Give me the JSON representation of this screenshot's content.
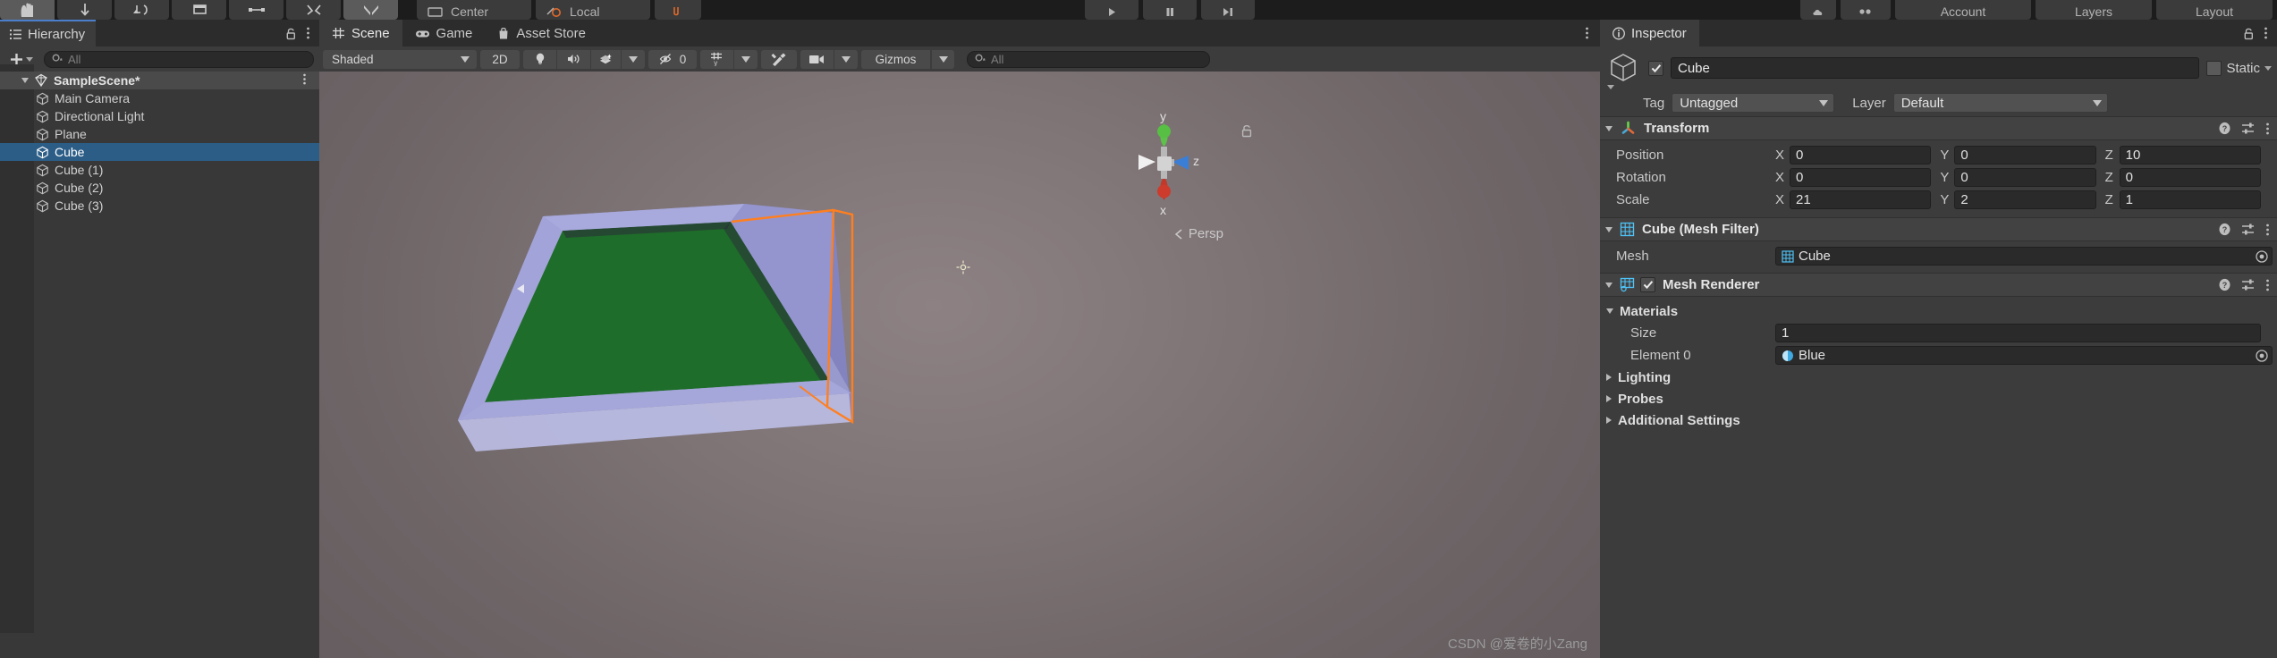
{
  "top_toolbar": {
    "tools": [
      {
        "name": "hand-tool",
        "icon": "hand",
        "active": true
      },
      {
        "name": "move-tool",
        "icon": "move"
      },
      {
        "name": "rotate-tool",
        "icon": "rotate"
      },
      {
        "name": "scale-tool",
        "icon": "scale"
      },
      {
        "name": "rect-tool",
        "icon": "rect"
      },
      {
        "name": "transform-tool",
        "icon": "transform"
      },
      {
        "name": "custom-tool",
        "icon": "custom"
      }
    ],
    "pivot_label": "Center",
    "handle_label": "Local",
    "play_label": "",
    "account_label": "Account",
    "layers_label": "Layers",
    "layout_label": "Layout"
  },
  "hierarchy": {
    "tab_label": "Hierarchy",
    "add_label": "+",
    "search_placeholder": "All",
    "items": [
      {
        "label": "SampleScene*",
        "depth": 0,
        "type": "scene",
        "expanded": true,
        "selected": false
      },
      {
        "label": "Main Camera",
        "depth": 1,
        "type": "gameobject",
        "selected": false
      },
      {
        "label": "Directional Light",
        "depth": 1,
        "type": "gameobject",
        "selected": false
      },
      {
        "label": "Plane",
        "depth": 1,
        "type": "gameobject",
        "selected": false
      },
      {
        "label": "Cube",
        "depth": 1,
        "type": "gameobject",
        "selected": true
      },
      {
        "label": "Cube (1)",
        "depth": 1,
        "type": "gameobject",
        "selected": false
      },
      {
        "label": "Cube (2)",
        "depth": 1,
        "type": "gameobject",
        "selected": false
      },
      {
        "label": "Cube (3)",
        "depth": 1,
        "type": "gameobject",
        "selected": false
      }
    ]
  },
  "scene_panel": {
    "tabs": [
      {
        "label": "Scene",
        "icon": "grid-icon",
        "active": true
      },
      {
        "label": "Game",
        "icon": "gamepad-icon",
        "active": false
      },
      {
        "label": "Asset Store",
        "icon": "store-icon",
        "active": false
      }
    ],
    "toolbar": {
      "draw_mode": "Shaded",
      "mode_2d": "2D",
      "lighting_icon": "lightbulb-icon",
      "audio_icon": "speaker-icon",
      "fx_icon": "effects-icon",
      "hidden_count": "0",
      "grid_icon": "grid-visibility-icon",
      "tools_icon": "component-tools-icon",
      "camera_icon": "scene-camera-icon",
      "gizmos_label": "Gizmos",
      "search_placeholder": "All"
    },
    "viewport": {
      "projection_label": "Persp",
      "gizmo_axes": {
        "y": "y",
        "z": "z",
        "x": "x"
      }
    },
    "watermark": "CSDN @爱卷的小Zang"
  },
  "inspector": {
    "tab_label": "Inspector",
    "object": {
      "enabled": true,
      "name": "Cube",
      "static_label": "Static",
      "static_checked": false,
      "tag_label": "Tag",
      "tag_value": "Untagged",
      "layer_label": "Layer",
      "layer_value": "Default"
    },
    "components": [
      {
        "title": "Transform",
        "icon": "transform-icon",
        "expanded": true,
        "rows": [
          {
            "label": "Position",
            "x": "0",
            "y": "0",
            "z": "10"
          },
          {
            "label": "Rotation",
            "x": "0",
            "y": "0",
            "z": "0"
          },
          {
            "label": "Scale",
            "x": "21",
            "y": "2",
            "z": "1"
          }
        ]
      },
      {
        "title": "Cube (Mesh Filter)",
        "icon": "mesh-filter-icon",
        "expanded": true,
        "mesh_label": "Mesh",
        "mesh_value": "Cube"
      },
      {
        "title": "Mesh Renderer",
        "icon": "mesh-renderer-icon",
        "expanded": true,
        "enabled": true,
        "materials_label": "Materials",
        "size_label": "Size",
        "size_value": "1",
        "element_label": "Element 0",
        "element_value": "Blue",
        "foldouts": [
          "Lighting",
          "Probes",
          "Additional Settings"
        ]
      }
    ]
  },
  "colors": {
    "accent_blue": "#2c5d87",
    "tab_underline": "#4b7fcd",
    "panel_bg": "#3c3c3c",
    "dark_bg": "#2c2c2c",
    "selection_orange": "#ff8c32",
    "cube_blue": "#9a9bd4",
    "plane_green": "#1f6d2a"
  }
}
